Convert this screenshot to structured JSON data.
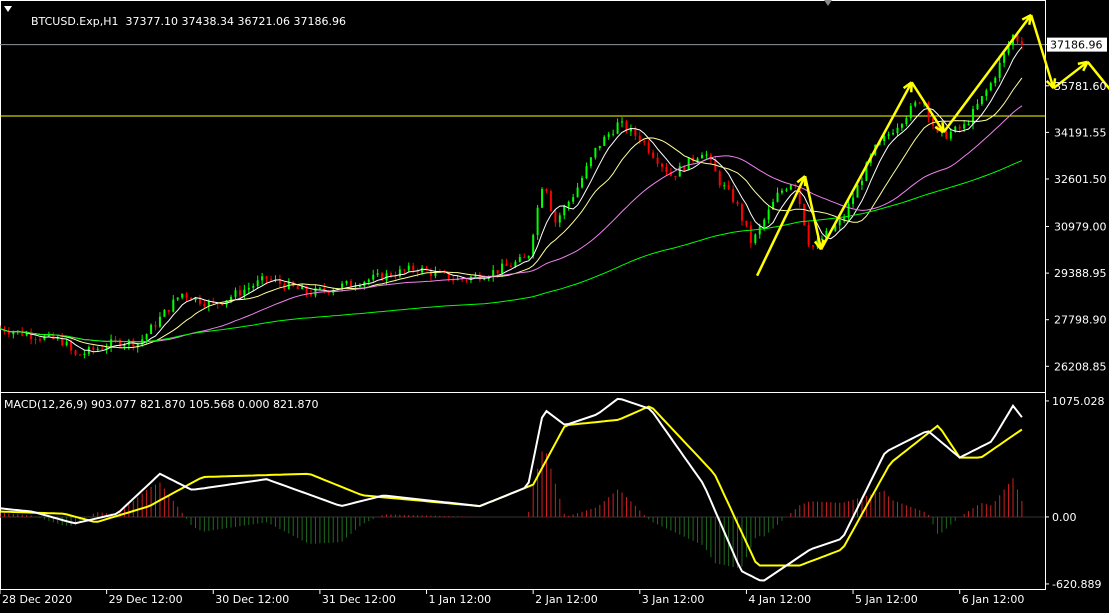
{
  "colors": {
    "background": "#000000",
    "axis": "#ffffff",
    "bull_candle": "#00ff00",
    "bear_candle": "#ff0000",
    "ma_fast": "#ffffff",
    "ma_mid": "#ffff99",
    "ma_slow": "#ee82ee",
    "ma_long": "#00ff00",
    "hline": "#ffff00",
    "price_line": "#8c96a0",
    "arrow": "#ffff00",
    "macd_main": "#ffffff",
    "macd_signal": "#ffff00",
    "hist_pos": "#cc2222",
    "hist_neg": "#1f6b1f"
  },
  "header": {
    "symbol": "BTCUSD.Exp,H1",
    "ohlc": "37377.10 37438.34 36721.06 37186.96",
    "dropdown_icon": "triangle-down-icon"
  },
  "macd_header": {
    "text": "MACD(12,26,9) 903.077 821.870 105.568 0.000 821.870"
  },
  "chart_data": [
    {
      "type": "candlestick",
      "symbol": "BTCUSD.Exp",
      "timeframe": "H1",
      "ylim": [
        25400,
        38300
      ],
      "yticks": [
        {
          "v": 37186.96,
          "label": "37186.96",
          "boxed": true
        },
        {
          "v": 35781.6,
          "label": "35781.60"
        },
        {
          "v": 34191.55,
          "label": "34191.55"
        },
        {
          "v": 32601.5,
          "label": "32601.50"
        },
        {
          "v": 30979.0,
          "label": "30979.00"
        },
        {
          "v": 29388.95,
          "label": "29388.95"
        },
        {
          "v": 27798.9,
          "label": "27798.90"
        },
        {
          "v": 26208.85,
          "label": "26208.85"
        }
      ],
      "xticks": [
        "28 Dec 2020",
        "29 Dec 12:00",
        "30 Dec 12:00",
        "31 Dec 12:00",
        "1 Jan 12:00",
        "2 Jan 12:00",
        "3 Jan 12:00",
        "4 Jan 12:00",
        "5 Jan 12:00",
        "6 Jan 12:00"
      ],
      "x_range_days": [
        0,
        9.8
      ],
      "xtick_days": [
        0,
        1,
        2,
        3,
        4,
        5,
        6,
        7,
        8,
        9
      ],
      "current_price": 37186.96,
      "horizontal_lines": [
        34750
      ],
      "anchors": [
        [
          0,
          27500
        ],
        [
          0.6,
          27050
        ],
        [
          0.7,
          26550
        ],
        [
          1.1,
          27050
        ],
        [
          1.3,
          27000
        ],
        [
          1.7,
          28700
        ],
        [
          2.0,
          28300
        ],
        [
          2.5,
          29200
        ],
        [
          2.9,
          28700
        ],
        [
          3.2,
          28950
        ],
        [
          3.9,
          29550
        ],
        [
          4.3,
          29150
        ],
        [
          4.6,
          29400
        ],
        [
          4.95,
          29900
        ],
        [
          5.1,
          32700
        ],
        [
          5.2,
          31100
        ],
        [
          5.4,
          32200
        ],
        [
          5.6,
          33700
        ],
        [
          5.8,
          34500
        ],
        [
          6.0,
          34000
        ],
        [
          6.3,
          32700
        ],
        [
          6.6,
          33600
        ],
        [
          6.75,
          32500
        ],
        [
          6.9,
          31800
        ],
        [
          7.05,
          30400
        ],
        [
          7.3,
          32100
        ],
        [
          7.45,
          32600
        ],
        [
          7.6,
          30200
        ],
        [
          7.9,
          31200
        ],
        [
          8.2,
          33600
        ],
        [
          8.4,
          34400
        ],
        [
          8.65,
          35400
        ],
        [
          8.8,
          34000
        ],
        [
          9.05,
          34400
        ],
        [
          9.3,
          35900
        ],
        [
          9.5,
          37500
        ],
        [
          9.6,
          37186.96
        ]
      ],
      "moving_averages": [
        {
          "key": "ma_fast",
          "color_key": "ma_fast",
          "period": 6
        },
        {
          "key": "ma_mid",
          "color_key": "ma_mid",
          "period": 14
        },
        {
          "key": "ma_slow",
          "color_key": "ma_slow",
          "period": 34
        },
        {
          "key": "ma_long",
          "color_key": "ma_long",
          "period": 110
        }
      ],
      "annotation_arrows": [
        [
          [
            7.1,
            29300
          ],
          [
            7.55,
            32700
          ],
          [
            7.7,
            30200
          ],
          [
            8.55,
            35900
          ],
          [
            8.85,
            34200
          ],
          [
            9.67,
            38200
          ],
          [
            9.88,
            35700
          ],
          [
            10.2,
            36600
          ],
          [
            10.6,
            34800
          ],
          [
            11.0,
            38600
          ]
        ]
      ]
    },
    {
      "type": "macd",
      "params": "12,26,9",
      "values": {
        "main": 903.077,
        "signal": 821.87,
        "histogram": 105.568
      },
      "ylim": [
        -640,
        1130
      ],
      "yticks": [
        {
          "v": 1075.028,
          "label": "1075.028"
        },
        {
          "v": 0,
          "label": "0.00"
        },
        {
          "v": -620.889,
          "label": "-620.889"
        }
      ],
      "main_anchors": [
        [
          0,
          80
        ],
        [
          0.3,
          50
        ],
        [
          0.7,
          -60
        ],
        [
          1.1,
          30
        ],
        [
          1.5,
          400
        ],
        [
          1.8,
          250
        ],
        [
          2.5,
          350
        ],
        [
          3.2,
          100
        ],
        [
          3.6,
          200
        ],
        [
          4.5,
          100
        ],
        [
          4.95,
          280
        ],
        [
          5.1,
          1000
        ],
        [
          5.3,
          850
        ],
        [
          5.6,
          950
        ],
        [
          5.8,
          1100
        ],
        [
          6.1,
          1000
        ],
        [
          6.6,
          300
        ],
        [
          6.95,
          -500
        ],
        [
          7.15,
          -600
        ],
        [
          7.6,
          -300
        ],
        [
          7.9,
          -200
        ],
        [
          8.3,
          600
        ],
        [
          8.7,
          800
        ],
        [
          9.0,
          550
        ],
        [
          9.3,
          700
        ],
        [
          9.5,
          1030
        ],
        [
          9.6,
          903.077
        ]
      ],
      "signal_anchors": [
        [
          0,
          50
        ],
        [
          0.6,
          30
        ],
        [
          0.9,
          -50
        ],
        [
          1.4,
          100
        ],
        [
          1.9,
          370
        ],
        [
          2.9,
          400
        ],
        [
          3.4,
          200
        ],
        [
          4.5,
          100
        ],
        [
          5.0,
          300
        ],
        [
          5.3,
          850
        ],
        [
          5.8,
          900
        ],
        [
          6.1,
          1030
        ],
        [
          6.7,
          400
        ],
        [
          7.1,
          -450
        ],
        [
          7.5,
          -450
        ],
        [
          7.9,
          -300
        ],
        [
          8.35,
          500
        ],
        [
          8.8,
          850
        ],
        [
          9.0,
          550
        ],
        [
          9.2,
          550
        ],
        [
          9.6,
          821.87
        ]
      ]
    }
  ]
}
